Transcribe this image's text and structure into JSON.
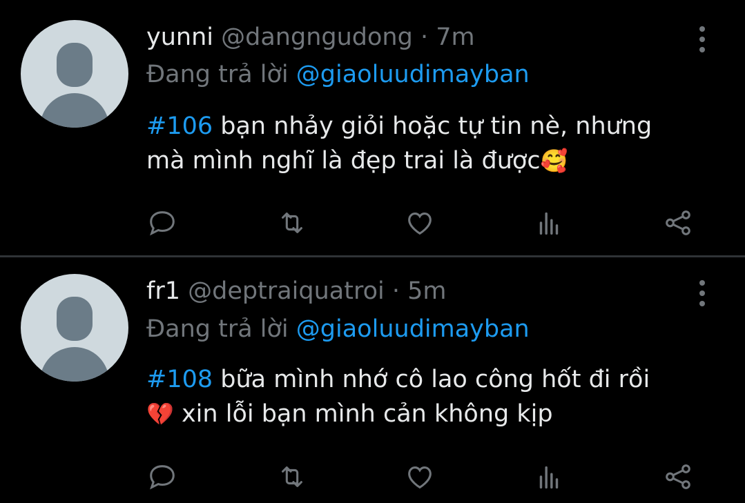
{
  "tweets": [
    {
      "name": "yunni",
      "handle": "@dangngudong",
      "separator": "·",
      "time": "7m",
      "reply_prefix": "Đang trả lời",
      "reply_to": "@giaoluudimayban",
      "hashtag": "#106",
      "text_line1": " bạn nhảy giỏi hoặc tự tin nè,  nhưng",
      "text_line2": "mà mình nghĩ là đẹp trai là được",
      "emoji": "🥰"
    },
    {
      "name": "fr1",
      "handle": "@deptraiquatroi",
      "separator": "·",
      "time": "5m",
      "reply_prefix": "Đang trả lời",
      "reply_to": "@giaoluudimayban",
      "hashtag": "#108",
      "text_line1": " bữa mình nhớ cô lao công hốt đi rồi",
      "emoji": "💔",
      "text_line2": "  xin lỗi bạn mình cản không kịp"
    }
  ],
  "icons": [
    "reply-icon",
    "retweet-icon",
    "like-icon",
    "views-icon",
    "share-icon",
    "more-icon"
  ],
  "colors": {
    "background": "#000000",
    "text": "#e7e9ea",
    "muted": "#71767b",
    "accent": "#1d9bf0",
    "divider": "#2f3336"
  }
}
